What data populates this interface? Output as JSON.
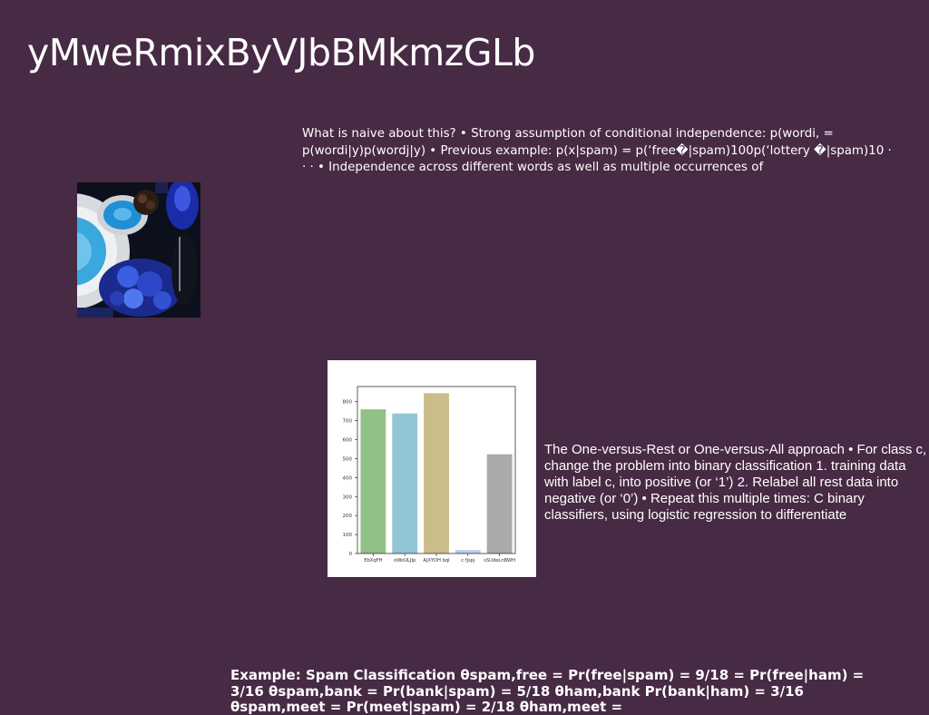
{
  "slide": {
    "title": "yMweRmixByVJbBMkmzGLb",
    "background_color": "#472A44",
    "text_color": "#ffffff"
  },
  "text_blocks": {
    "naive": "What is naive about this? • Strong assumption of conditional independence: p(wordi, = p(wordi|y)p(wordj|y) • Previous example: p(x|spam) = p(‘free�|spam)100p(‘lottery �|spam)10 · · · • Independence across different words as well as multiple occurrences of",
    "ovr": "The One-versus-Rest or One-versus-All approach • For class c, change the problem into binary classification 1. training data with label c, into positive (or ‘1’) 2. Relabel all rest data into negative (or ‘0’) • Repeat this multiple times: C binary classifiers, using logistic regression to differentiate",
    "spam": "Example: Spam Classification θspam,free = Pr(free|spam) = 9/18 = Pr(free|ham) = 3/16 θspam,bank = Pr(bank|spam) = 5/18 θham,bank Pr(bank|ham) = 3/16 θspam,meet = Pr(meet|spam) = 2/18 θham,meet ="
  },
  "photo": {
    "alt": "photo of blue dishes"
  },
  "chart_data": {
    "type": "bar",
    "categories": [
      "EbXqFH",
      "oWoULJIp",
      "AjXYDH bql",
      "c fjspj",
      "sSUdeLnBWH"
    ],
    "values": [
      760,
      738,
      845,
      18,
      523
    ],
    "colors": [
      "#92C187",
      "#92C6D7",
      "#CBBD8A",
      "#B9CBF0",
      "#A8AAAB"
    ],
    "ylim": [
      0,
      880
    ],
    "yticks": [
      0,
      100,
      200,
      300,
      400,
      500,
      600,
      700,
      800
    ],
    "title": "",
    "xlabel": "",
    "ylabel": ""
  }
}
